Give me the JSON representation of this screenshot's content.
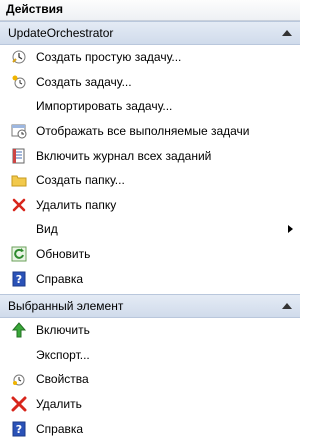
{
  "pane": {
    "title": "Действия"
  },
  "sections": {
    "orchestrator": {
      "title": "UpdateOrchestrator",
      "items": [
        {
          "label": "Создать простую задачу...",
          "icon": "basic-task-icon"
        },
        {
          "label": "Создать задачу...",
          "icon": "create-task-icon"
        },
        {
          "label": "Импортировать задачу...",
          "icon": ""
        },
        {
          "label": "Отображать все выполняемые задачи",
          "icon": "running-tasks-icon"
        },
        {
          "label": "Включить журнал всех заданий",
          "icon": "history-log-icon"
        },
        {
          "label": "Создать папку...",
          "icon": "folder-icon"
        },
        {
          "label": "Удалить папку",
          "icon": "delete-icon"
        },
        {
          "label": "Вид",
          "icon": ""
        },
        {
          "label": "Обновить",
          "icon": "refresh-icon"
        },
        {
          "label": "Справка",
          "icon": "help-icon"
        }
      ]
    },
    "selected": {
      "title": "Выбранный элемент",
      "items": [
        {
          "label": "Включить",
          "icon": "enable-arrow-icon"
        },
        {
          "label": "Экспорт...",
          "icon": ""
        },
        {
          "label": "Свойства",
          "icon": "properties-icon"
        },
        {
          "label": "Удалить",
          "icon": "delete-icon"
        },
        {
          "label": "Справка",
          "icon": "help-icon"
        }
      ]
    }
  },
  "colors": {
    "header_bg": "#d6e0ee",
    "delete_red": "#d8261c",
    "help_blue": "#2a52b8",
    "enable_green": "#3aa83a",
    "folder_yellow": "#f2c94c"
  }
}
